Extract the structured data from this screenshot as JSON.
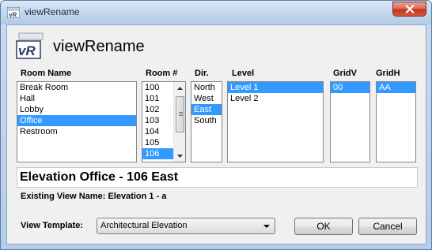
{
  "window": {
    "title": "viewRename",
    "close_icon": "close-icon"
  },
  "header": {
    "logo_text": "vR",
    "app_title": "viewRename"
  },
  "columns": {
    "room_name": "Room Name",
    "room_number": "Room #",
    "direction": "Dir.",
    "level": "Level",
    "gridv": "GridV",
    "gridh": "GridH"
  },
  "room_names": {
    "items": [
      "Break Room",
      "Hall",
      "Lobby",
      "Office",
      "Restroom"
    ],
    "selected": "Office"
  },
  "room_numbers": {
    "items": [
      "100",
      "101",
      "102",
      "103",
      "104",
      "105",
      "106"
    ],
    "selected": "106"
  },
  "directions": {
    "items": [
      "North",
      "West",
      "East",
      "South"
    ],
    "selected": "East"
  },
  "levels": {
    "items": [
      "Level 1",
      "Level 2"
    ],
    "selected": "Level 1"
  },
  "gridv": {
    "items": [
      "00"
    ],
    "selected": "00"
  },
  "gridh": {
    "items": [
      "AA"
    ],
    "selected": "AA"
  },
  "new_view_name": "Elevation Office - 106 East",
  "existing_view_name": "Existing View Name: Elevation 1 - a",
  "view_template": {
    "label": "View Template:",
    "selected": "Architectural Elevation"
  },
  "buttons": {
    "ok": "OK",
    "cancel": "Cancel"
  },
  "colors": {
    "selection": "#3399ff",
    "title_bar": "#c3d7ee",
    "close_button": "#c1361c"
  }
}
